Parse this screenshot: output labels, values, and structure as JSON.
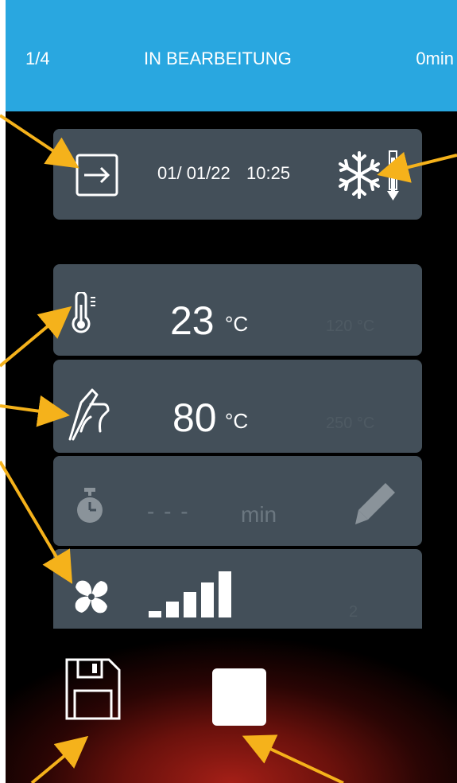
{
  "header": {
    "step": "1/4",
    "title": "IN BEARBEITUNG",
    "elapsed": "0min"
  },
  "start": {
    "date": "01/ 01/22",
    "time": "10:25"
  },
  "temperature": {
    "value": "23",
    "unit": "°C",
    "max": "120 °C"
  },
  "core": {
    "value": "80",
    "unit": "°C",
    "max": "250 °C"
  },
  "timer": {
    "value": "- - -",
    "unit": "min"
  },
  "fan": {
    "level_label": "2",
    "level": 2
  },
  "colors": {
    "header": "#29a7e0",
    "card": "#434f59",
    "arrow": "#f5b21b",
    "accent_red": "#a41f17"
  },
  "icons": [
    "enter-icon",
    "freeze-icon",
    "thermometer-icon",
    "core-probe-icon",
    "stopwatch-icon",
    "pencil-icon",
    "fan-icon",
    "fan-level-bars-icon",
    "save-icon",
    "stop-icon"
  ]
}
